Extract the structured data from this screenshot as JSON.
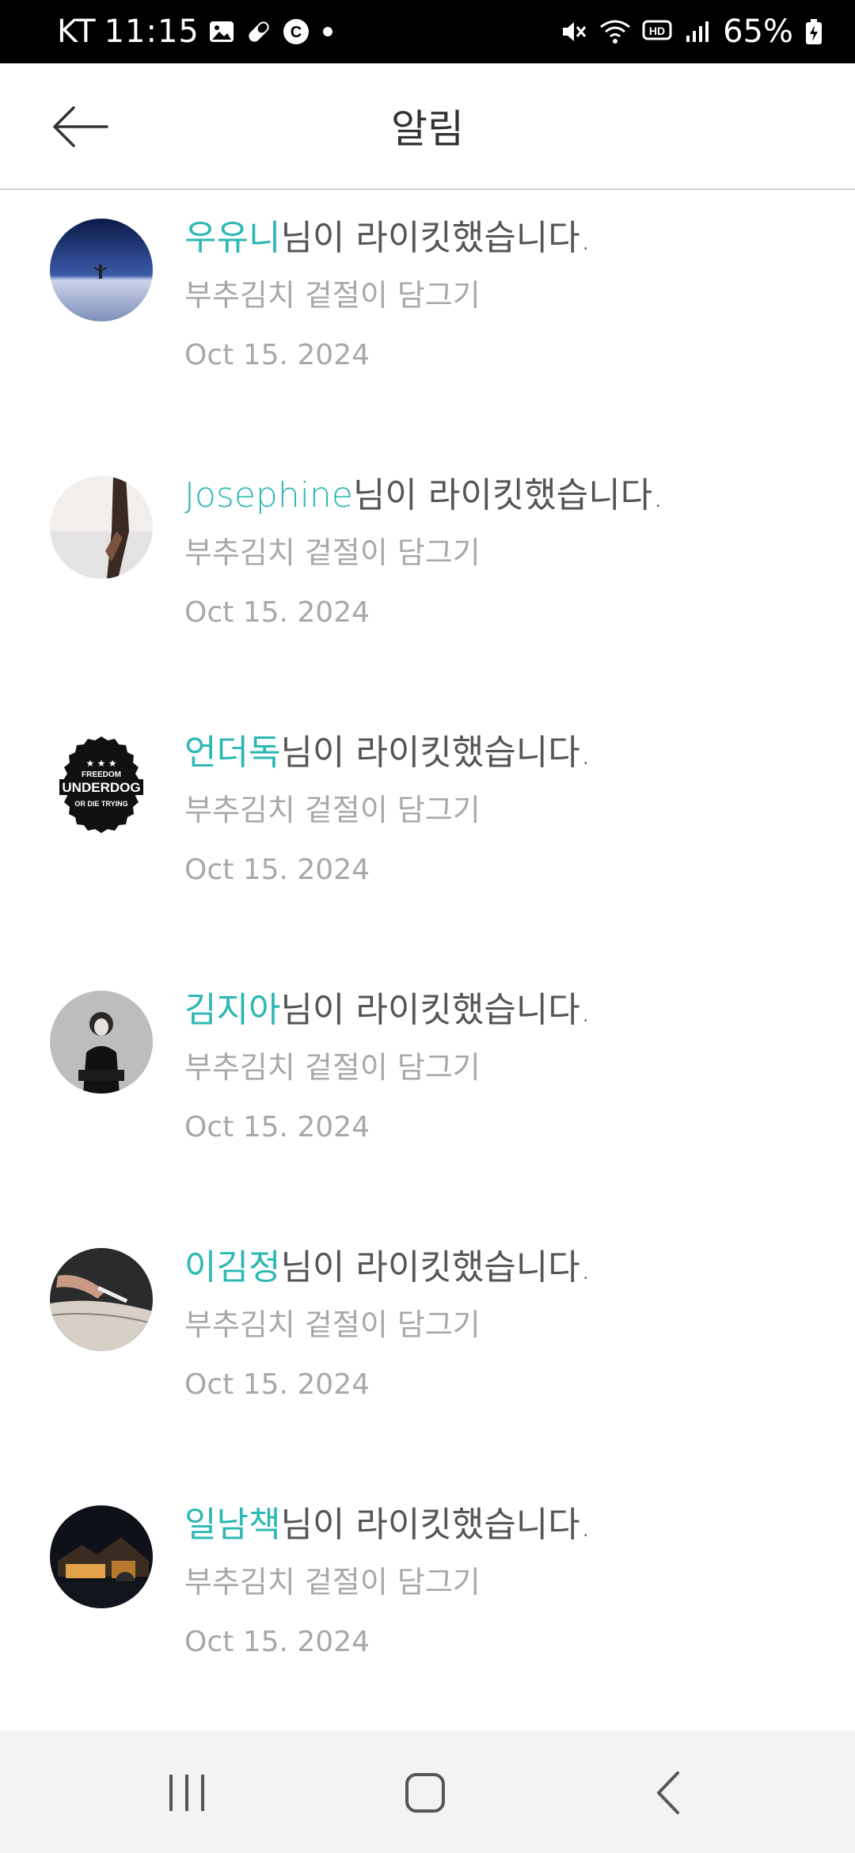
{
  "status_bar": {
    "carrier": "KT",
    "time": "11:15",
    "battery": "65%"
  },
  "header": {
    "title": "알림"
  },
  "notifications": [
    {
      "user": "우유니",
      "action": "님이 라이킷했습니다.",
      "post": "부추김치 겉절이 담그기",
      "date": "Oct 15. 2024"
    },
    {
      "user": "Josephine",
      "action": "님이 라이킷했습니다.",
      "post": "부추김치 겉절이 담그기",
      "date": "Oct 15. 2024"
    },
    {
      "user": "언더독",
      "action": "님이 라이킷했습니다.",
      "post": "부추김치 겉절이 담그기",
      "date": "Oct 15. 2024",
      "avatar_text": {
        "top": "FREEDOM",
        "main": "UNDERDOG",
        "bottom": "OR DIE TRYING"
      }
    },
    {
      "user": "김지아",
      "action": "님이 라이킷했습니다.",
      "post": "부추김치 겉절이 담그기",
      "date": "Oct 15. 2024"
    },
    {
      "user": "이김정",
      "action": "님이 라이킷했습니다.",
      "post": "부추김치 겉절이 담그기",
      "date": "Oct 15. 2024"
    },
    {
      "user": "일남책",
      "action": "님이 라이킷했습니다.",
      "post": "부추김치 겉절이 담그기",
      "date": "Oct 15. 2024"
    }
  ],
  "colors": {
    "username": "#2cb8b3",
    "text": "#555555",
    "muted": "#a8a8a8"
  }
}
